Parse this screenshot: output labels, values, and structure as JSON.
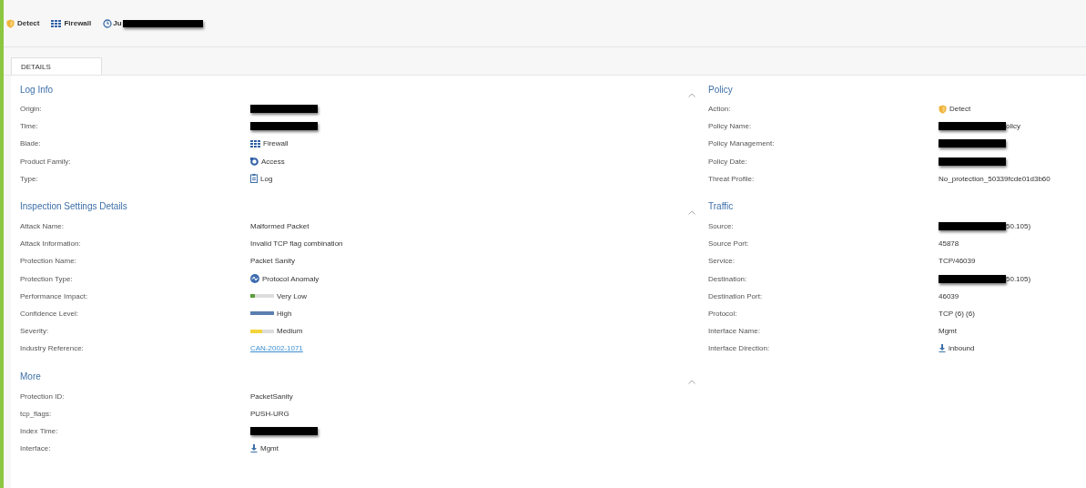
{
  "header_items": [
    {
      "kind": "shield",
      "label": "Detect",
      "redacted": false
    },
    {
      "kind": "grid",
      "label": "Firewall",
      "redacted": false
    },
    {
      "kind": "clock",
      "label": "Ju",
      "redacted": true
    }
  ],
  "tabs": [
    {
      "label": "DETAILS",
      "selected": true
    }
  ],
  "columns": [
    [
      {
        "title": "Log Info",
        "expanded": true,
        "rows": [
          {
            "label": "Origin:",
            "kind": "redacted"
          },
          {
            "label": "Time:",
            "kind": "redacted"
          },
          {
            "label": "Blade:",
            "kind": "grid",
            "value": "Firewall"
          },
          {
            "label": "Product Family:",
            "kind": "access",
            "value": "Access"
          },
          {
            "label": "Type:",
            "kind": "log",
            "value": "Log"
          }
        ]
      },
      {
        "title": "Inspection Settings Details",
        "expanded": true,
        "rows": [
          {
            "label": "Attack Name:",
            "kind": "text",
            "value": "Malformed Packet"
          },
          {
            "label": "Attack Information:",
            "kind": "text",
            "value": "Invalid TCP flag combination"
          },
          {
            "label": "Protection Name:",
            "kind": "text",
            "value": "Packet Sanity"
          },
          {
            "label": "Protection Type:",
            "kind": "anomaly",
            "value": "Protocol Anomaly"
          },
          {
            "label": "Performance Impact:",
            "kind": "meter",
            "level": 0.2,
            "color": "#5a9e3a",
            "value": "Very Low"
          },
          {
            "label": "Confidence Level:",
            "kind": "meter",
            "level": 1,
            "color": "#5b7fb0",
            "value": "High"
          },
          {
            "label": "Severity:",
            "kind": "meter",
            "level": 0.5,
            "color": "#f2d43c",
            "value": "Medium"
          },
          {
            "label": "Industry Reference:",
            "kind": "link",
            "value": "CAN-2002-1071"
          }
        ]
      },
      {
        "title": "More",
        "expanded": true,
        "rows": [
          {
            "label": "Protection ID:",
            "kind": "text",
            "value": "PacketSanity"
          },
          {
            "label": "tcp_flags:",
            "kind": "text",
            "value": "PUSH-URG"
          },
          {
            "label": "Index Time:",
            "kind": "redacted"
          },
          {
            "label": "Interface:",
            "kind": "download",
            "value": "Mgmt"
          }
        ]
      }
    ],
    [
      {
        "title": "Policy",
        "rows": [
          {
            "label": "Action:",
            "kind": "shield",
            "value": "Detect"
          },
          {
            "label": "Policy Name:",
            "kind": "redacted",
            "after": "olicy"
          },
          {
            "label": "Policy Management:",
            "kind": "redacted"
          },
          {
            "label": "Policy Date:",
            "kind": "redacted"
          },
          {
            "label": "Threat Profile:",
            "kind": "text",
            "value": "No_protection_50339fcde01d3b60"
          }
        ]
      },
      {
        "title": "Traffic",
        "rows": [
          {
            "label": "Source:",
            "kind": "redacted",
            "after": "50.105)"
          },
          {
            "label": "Source Port:",
            "kind": "text",
            "value": "45878"
          },
          {
            "label": "Service:",
            "kind": "text",
            "value": "TCP/46039"
          },
          {
            "label": "Destination:",
            "kind": "redacted",
            "after": "50.105)"
          },
          {
            "label": "Destination Port:",
            "kind": "text",
            "value": "46039"
          },
          {
            "label": "Protocol:",
            "kind": "text",
            "value": "TCP (6) (6)"
          },
          {
            "label": "Interface Name:",
            "kind": "text",
            "value": "Mgmt"
          },
          {
            "label": "Interface Direction:",
            "kind": "download",
            "value": "inbound"
          }
        ]
      }
    ]
  ]
}
